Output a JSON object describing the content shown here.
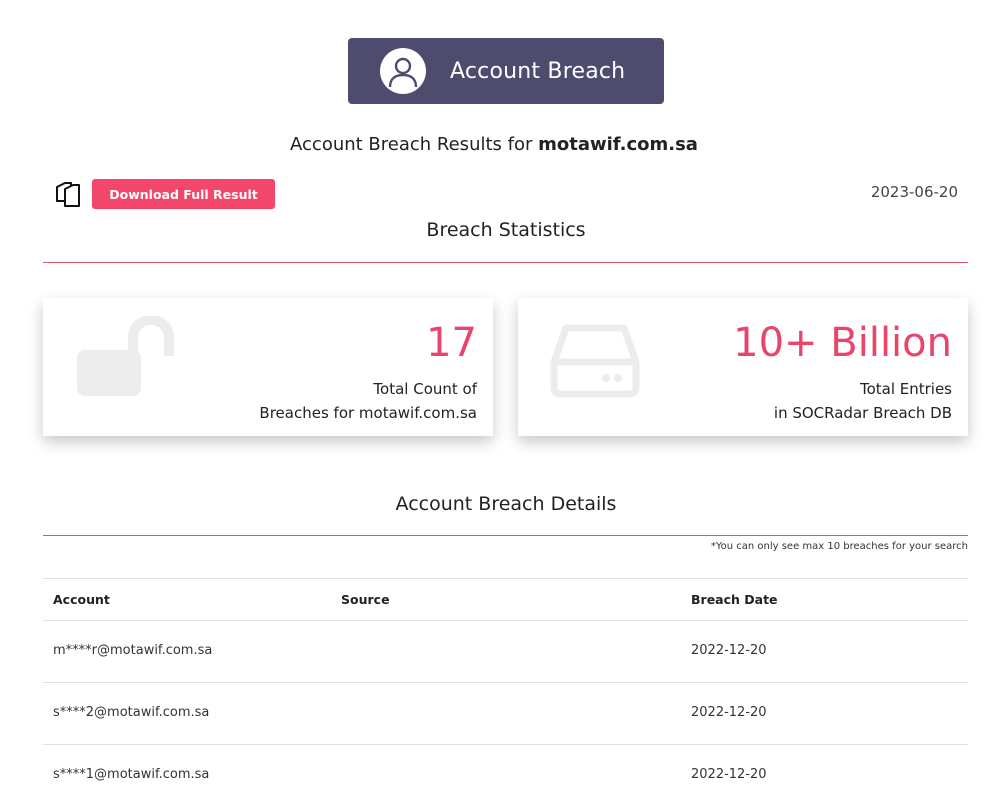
{
  "banner": {
    "title": "Account Breach",
    "icon": "user-icon"
  },
  "results": {
    "prefix": "Account Breach Results for ",
    "domain": "motawif.com.sa"
  },
  "toolbar": {
    "copy_icon": "copy-icon",
    "download_label": "Download Full Result",
    "date": "2023-06-20"
  },
  "statistics": {
    "title": "Breach Statistics",
    "cards": [
      {
        "icon": "unlock-icon",
        "value": "17",
        "line1": "Total Count of",
        "line2": "Breaches for motawif.com.sa"
      },
      {
        "icon": "hard-drive-icon",
        "value": "10+ Billion",
        "line1": "Total Entries",
        "line2": "in SOCRadar Breach DB"
      }
    ]
  },
  "details": {
    "title": "Account Breach Details",
    "note": "*You can only see max 10 breaches for your search",
    "columns": [
      "Account",
      "Source",
      "Breach Date"
    ],
    "rows": [
      {
        "account": "m****r@motawif.com.sa",
        "source": "",
        "date": "2022-12-20"
      },
      {
        "account": "s****2@motawif.com.sa",
        "source": "",
        "date": "2022-12-20"
      },
      {
        "account": "s****1@motawif.com.sa",
        "source": "",
        "date": "2022-12-20"
      }
    ]
  },
  "colors": {
    "banner_bg": "#4d4c6e",
    "accent": "#e9456a",
    "button": "#f2476a"
  }
}
